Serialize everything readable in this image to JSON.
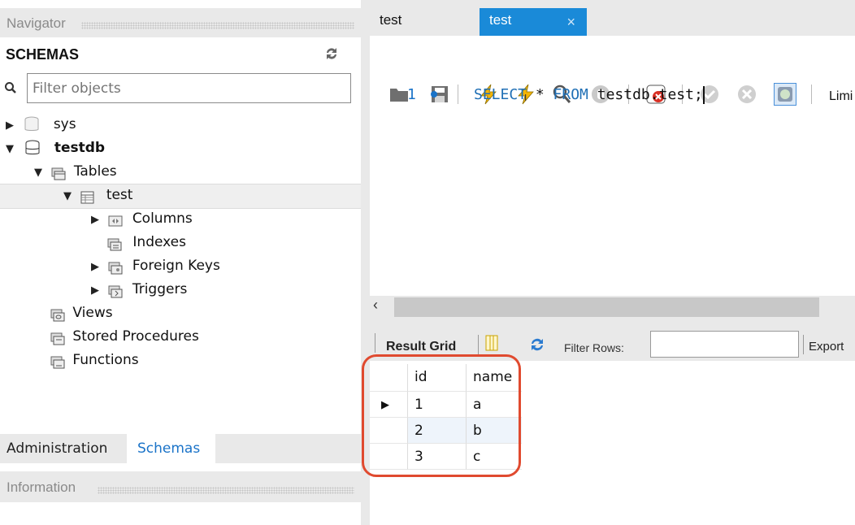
{
  "navigator": {
    "title": "Navigator",
    "schemas_header": "SCHEMAS",
    "filter_placeholder": "Filter objects",
    "tree": {
      "sys": "sys",
      "testdb": "testdb",
      "tables": "Tables",
      "test": "test",
      "columns": "Columns",
      "indexes": "Indexes",
      "foreign_keys": "Foreign Keys",
      "triggers": "Triggers",
      "views": "Views",
      "stored_procedures": "Stored Procedures",
      "functions": "Functions"
    },
    "bottom_tabs": [
      "Administration",
      "Schemas"
    ],
    "information_title": "Information"
  },
  "editor": {
    "tabs": [
      "test",
      "test"
    ],
    "limit_label": "Limi",
    "line_number": "1",
    "sql": {
      "kw1": "SELECT",
      "star": " * ",
      "kw2": "FROM",
      "table": " testdb.test;"
    }
  },
  "result": {
    "grid_label": "Result Grid",
    "filter_label": "Filter Rows:",
    "export_label": "Export",
    "columns": [
      "id",
      "name"
    ],
    "rows": [
      [
        "1",
        "a"
      ],
      [
        "2",
        "b"
      ],
      [
        "3",
        "c"
      ]
    ]
  },
  "colors": {
    "accent": "#1a73c8",
    "highlight": "#e04a2f",
    "keyword": "#1f6fb5"
  }
}
